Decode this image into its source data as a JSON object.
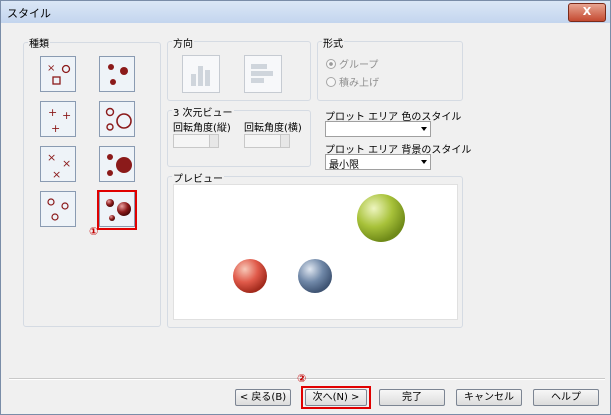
{
  "window": {
    "title": "スタイル",
    "close_label": "X"
  },
  "type_group": {
    "label": "種類",
    "selected_marker": "①"
  },
  "direction_group": {
    "label": "方向"
  },
  "format_group": {
    "label": "形式",
    "options": [
      {
        "label": "グループ",
        "checked": true
      },
      {
        "label": "積み上げ",
        "checked": false
      }
    ]
  },
  "view3d_group": {
    "label": "3 次元ビュー",
    "vertical_rotation_label": "回転角度(縦)",
    "horizontal_rotation_label": "回転角度(横)"
  },
  "plot_area": {
    "color_style_label": "プロット エリア 色のスタイル",
    "color_style_value": "",
    "bg_style_label": "プロット エリア 背景のスタイル",
    "bg_style_value": "最小限"
  },
  "preview": {
    "label": "プレビュー"
  },
  "buttons": {
    "back": "< 戻る(B)",
    "next": "次へ(N) >",
    "finish": "完了",
    "cancel": "キャンセル",
    "help": "ヘルプ"
  },
  "next_marker": "②",
  "colors": {
    "highlight": "#e00000",
    "marker_dark": "#8b1a1a",
    "sphere_green": "#a8c23a",
    "sphere_red": "#e05a4a",
    "sphere_blue": "#7088a8"
  }
}
